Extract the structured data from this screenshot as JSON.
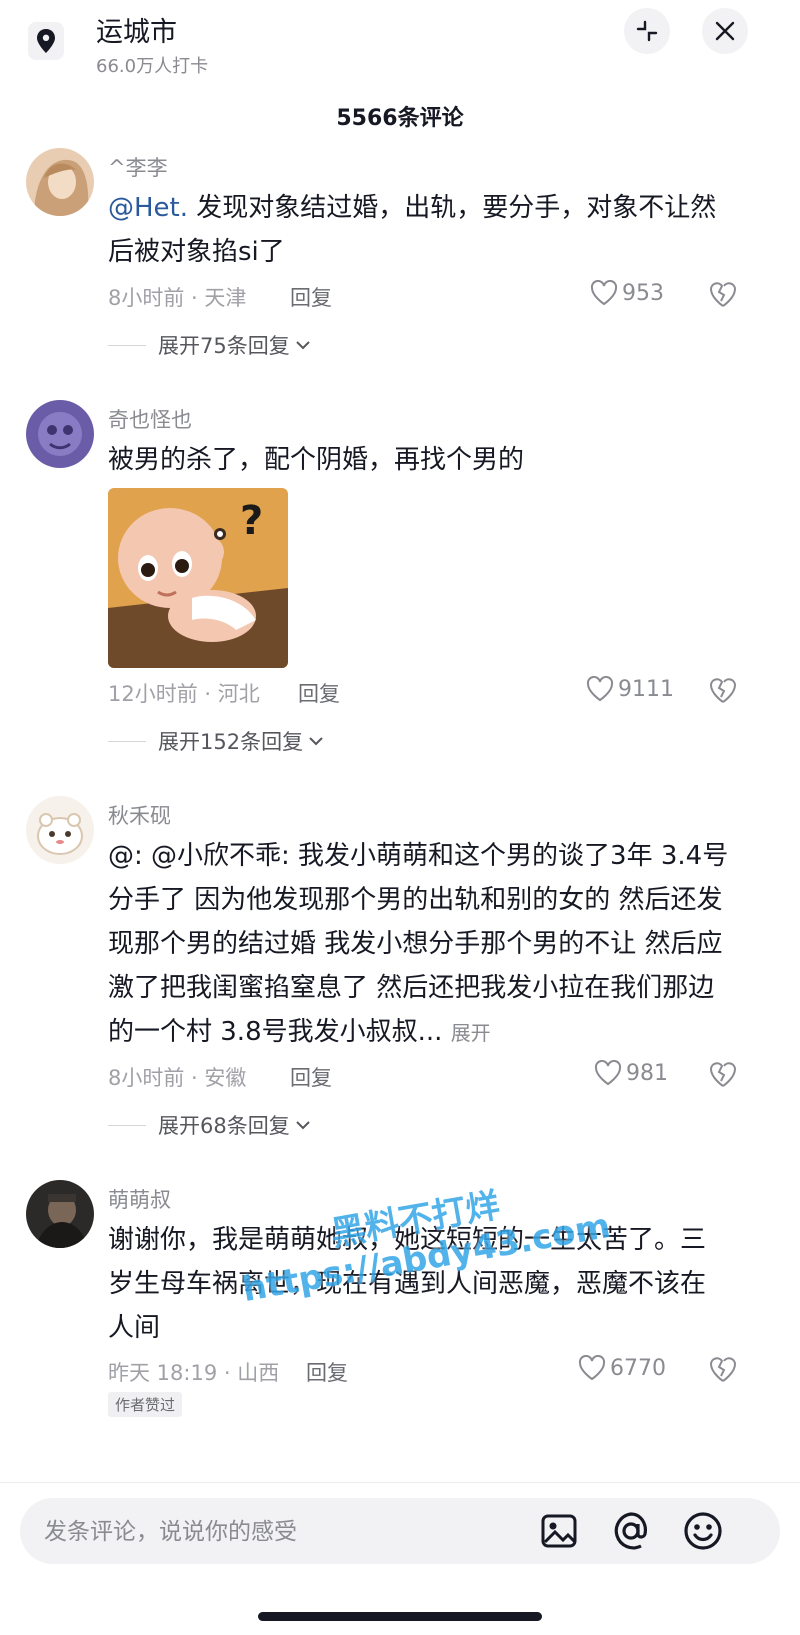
{
  "header": {
    "city": "运城市",
    "checkins": "66.0万人打卡",
    "comment_count": "5566条评论"
  },
  "comments": [
    {
      "username": "^李李",
      "mention": "@Het.",
      "text_line1": " 发现对象结过婚，出轨，要分手，对象不让然",
      "text_line2": "后被对象掐si了",
      "meta": "8小时前 · 天津",
      "reply": "回复",
      "likes": "953",
      "expand": "展开75条回复"
    },
    {
      "username": "奇也怪也",
      "text_line1": "被男的杀了，配个阴婚，再找个男的",
      "meta": "12小时前 · 河北",
      "reply": "回复",
      "likes": "9111",
      "expand": "展开152条回复"
    },
    {
      "username": "秋禾砚",
      "text_line1": "@: @小欣不乖: 我发小萌萌和这个男的谈了3年 3.4号",
      "text_line2": "分手了 因为他发现那个男的出轨和别的女的 然后还发",
      "text_line3": "现那个男的结过婚 我发小想分手那个男的不让 然后应",
      "text_line4": "激了把我闺蜜掐窒息了 然后还把我发小拉在我们那边",
      "text_line5": "的一个村 3.8号我发小叔叔...",
      "more": "展开",
      "meta": "8小时前 · 安徽",
      "reply": "回复",
      "likes": "981",
      "expand": "展开68条回复"
    },
    {
      "username": "萌萌叔",
      "text_line1": "谢谢你，我是萌萌她叔，她这短短的一生太苦了。三",
      "text_line2": "岁生母车祸离世，现在有遇到人间恶魔，恶魔不该在",
      "text_line3": "人间",
      "meta": "昨天 18:19 · 山西",
      "reply": "回复",
      "likes": "6770",
      "badge": "作者赞过"
    }
  ],
  "input": {
    "placeholder": "发条评论，说说你的感受"
  },
  "watermark": {
    "line1": "黑料不打烊",
    "line2": "https://abdy43.com"
  },
  "colors": {
    "mention": "#2b5a9c",
    "text": "#161823",
    "secondary": "#8a8b91",
    "watermark": "#35a6e8"
  }
}
